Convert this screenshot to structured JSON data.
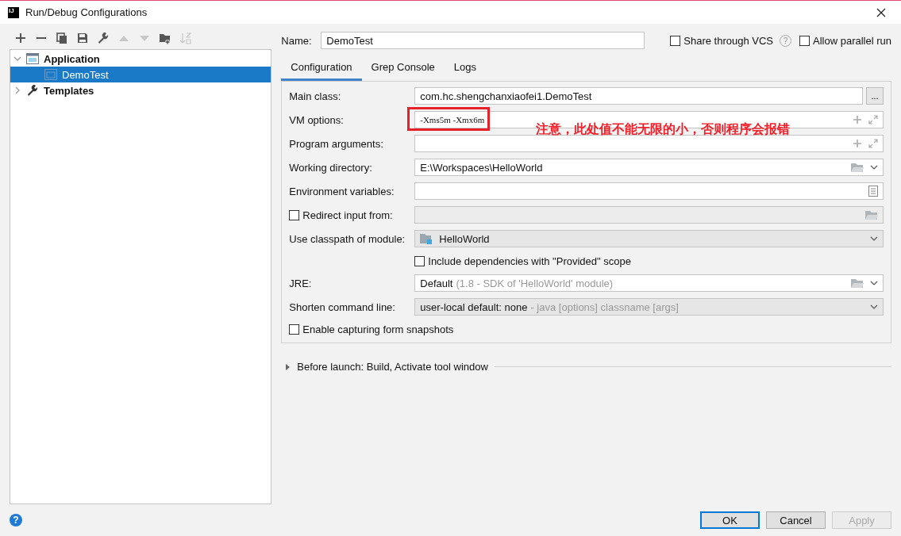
{
  "window": {
    "app_icon": "IJ",
    "title": "Run/Debug Configurations"
  },
  "toolbar": [
    {
      "kind": "add",
      "disabled": false
    },
    {
      "kind": "remove",
      "disabled": false
    },
    {
      "kind": "copy",
      "disabled": false
    },
    {
      "kind": "save",
      "disabled": false
    },
    {
      "kind": "wrench",
      "disabled": false
    },
    {
      "kind": "up",
      "disabled": true
    },
    {
      "kind": "down",
      "disabled": true
    },
    {
      "kind": "folder",
      "disabled": false
    },
    {
      "kind": "sort",
      "disabled": true
    }
  ],
  "tree": [
    {
      "label": "Application",
      "kind": "application",
      "expanded": true,
      "selected": false,
      "children": [
        {
          "label": "DemoTest",
          "kind": "config",
          "selected": true
        }
      ]
    },
    {
      "label": "Templates",
      "kind": "templates",
      "expanded": false,
      "selected": false
    }
  ],
  "name": {
    "label": "Name:",
    "value": "DemoTest"
  },
  "share": {
    "label": "Share through VCS",
    "checked": false,
    "help": "?"
  },
  "parallel": {
    "label": "Allow parallel run",
    "checked": false
  },
  "tabs": [
    {
      "label": "Configuration",
      "selected": true
    },
    {
      "label": "Grep Console",
      "selected": false
    },
    {
      "label": "Logs",
      "selected": false
    }
  ],
  "rows": [
    {
      "kind": "text",
      "label": "Main class:",
      "value": "com.hc.shengchanxiaofei1.DemoTest",
      "browse": "..."
    },
    {
      "kind": "expand",
      "label": "VM options:",
      "value": "-Xms5m  -Xmx6m",
      "mono": true,
      "highlight": true,
      "note": "注意，此处值不能无限的小，否则程序会报错"
    },
    {
      "kind": "expand",
      "label": "Program arguments:"
    },
    {
      "kind": "path",
      "label": "Working directory:",
      "value": "E:\\Workspaces\\HelloWorld"
    },
    {
      "kind": "env",
      "label": "Environment variables:"
    },
    {
      "kind": "checkbox-field",
      "label": "Redirect input from:",
      "checked": false
    },
    {
      "kind": "combo",
      "label": "Use classpath of module:",
      "value": "HelloWorld",
      "module": true
    },
    {
      "kind": "sub-checkbox",
      "label": "Include dependencies with \"Provided\" scope",
      "checked": false
    },
    {
      "kind": "path",
      "label": "JRE:",
      "value": "Default",
      "hint": "(1.8 - SDK of 'HelloWorld' module)"
    },
    {
      "kind": "combo",
      "label": "Shorten command line:",
      "value": "user-local default: none",
      "hint": "- java [options] classname [args]"
    },
    {
      "kind": "checkbox",
      "label": "Enable capturing form snapshots",
      "checked": false
    }
  ],
  "before_launch": {
    "label": "Before launch: Build, Activate tool window",
    "expanded": false
  },
  "help": "?",
  "buttons": [
    {
      "label": "OK",
      "kind": "default",
      "disabled": false
    },
    {
      "label": "Cancel",
      "kind": "normal",
      "disabled": false
    },
    {
      "label": "Apply",
      "kind": "normal",
      "disabled": true
    }
  ]
}
